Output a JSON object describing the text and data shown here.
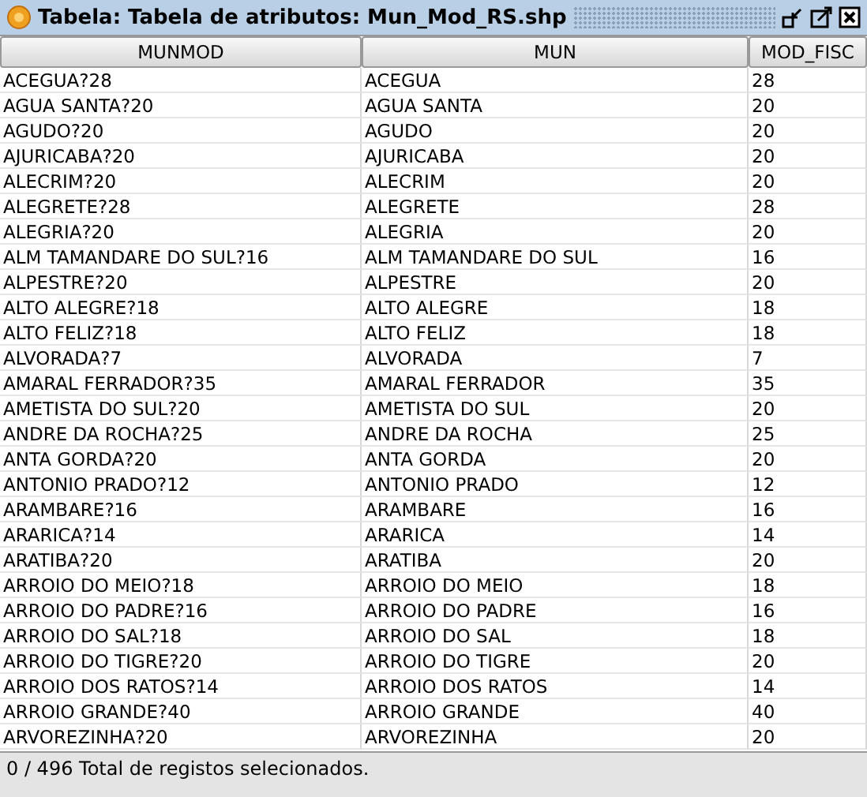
{
  "window": {
    "title": "Tabela: Tabela de atributos: Mun_Mod_RS.shp"
  },
  "table": {
    "columns": [
      "MUNMOD",
      "MUN",
      "MOD_FISC"
    ],
    "rows": [
      [
        "ACEGUA?28",
        "ACEGUA",
        "28"
      ],
      [
        "AGUA SANTA?20",
        "AGUA SANTA",
        "20"
      ],
      [
        "AGUDO?20",
        "AGUDO",
        "20"
      ],
      [
        "AJURICABA?20",
        "AJURICABA",
        "20"
      ],
      [
        "ALECRIM?20",
        "ALECRIM",
        "20"
      ],
      [
        "ALEGRETE?28",
        "ALEGRETE",
        "28"
      ],
      [
        "ALEGRIA?20",
        "ALEGRIA",
        "20"
      ],
      [
        "ALM TAMANDARE DO SUL?16",
        "ALM TAMANDARE DO SUL",
        "16"
      ],
      [
        "ALPESTRE?20",
        "ALPESTRE",
        "20"
      ],
      [
        "ALTO ALEGRE?18",
        "ALTO ALEGRE",
        "18"
      ],
      [
        "ALTO FELIZ?18",
        "ALTO FELIZ",
        "18"
      ],
      [
        "ALVORADA?7",
        "ALVORADA",
        "7"
      ],
      [
        "AMARAL FERRADOR?35",
        "AMARAL FERRADOR",
        "35"
      ],
      [
        "AMETISTA DO SUL?20",
        "AMETISTA DO SUL",
        "20"
      ],
      [
        "ANDRE DA ROCHA?25",
        "ANDRE DA ROCHA",
        "25"
      ],
      [
        "ANTA GORDA?20",
        "ANTA GORDA",
        "20"
      ],
      [
        "ANTONIO PRADO?12",
        "ANTONIO PRADO",
        "12"
      ],
      [
        "ARAMBARE?16",
        "ARAMBARE",
        "16"
      ],
      [
        "ARARICA?14",
        "ARARICA",
        "14"
      ],
      [
        "ARATIBA?20",
        "ARATIBA",
        "20"
      ],
      [
        "ARROIO DO MEIO?18",
        "ARROIO DO MEIO",
        "18"
      ],
      [
        "ARROIO DO PADRE?16",
        "ARROIO DO PADRE",
        "16"
      ],
      [
        "ARROIO DO SAL?18",
        "ARROIO DO SAL",
        "18"
      ],
      [
        "ARROIO DO TIGRE?20",
        "ARROIO DO TIGRE",
        "20"
      ],
      [
        "ARROIO DOS RATOS?14",
        "ARROIO DOS RATOS",
        "14"
      ],
      [
        "ARROIO GRANDE?40",
        "ARROIO GRANDE",
        "40"
      ],
      [
        "ARVOREZINHA?20",
        "ARVOREZINHA",
        "20"
      ]
    ]
  },
  "status_bar": "0 / 496 Total de registos selecionados."
}
